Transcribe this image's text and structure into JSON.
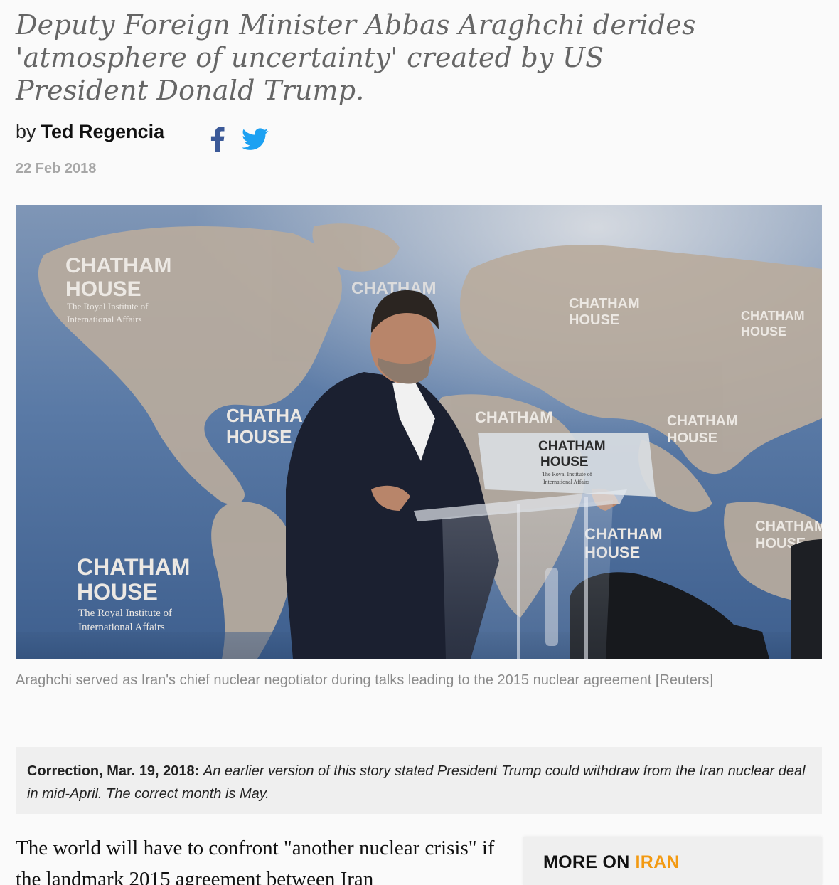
{
  "article": {
    "subhead": "Deputy Foreign Minister Abbas Araghchi derides 'atmosphere of uncertainty' created by US President Donald Trump.",
    "byline_prefix": "by",
    "author": "Ted Regencia",
    "date": "22 Feb 2018",
    "share": {
      "facebook_icon": "facebook-icon",
      "twitter_icon": "twitter-icon",
      "facebook_color": "#3b5998",
      "twitter_color": "#1da1f2"
    },
    "image": {
      "backdrop_logos": [
        {
          "name": "CHATHAM",
          "name2": "HOUSE",
          "sub1": "The Royal Institute of",
          "sub2": "International Affairs"
        }
      ],
      "podium_sign": {
        "line1": "CHATHAM",
        "line2": "HOUSE",
        "sub1": "The Royal Institute of",
        "sub2": "International Affairs"
      }
    },
    "caption": "Araghchi served as Iran's chief nuclear negotiator during talks leading to the 2015 nuclear agreement [Reuters]",
    "correction": {
      "label": "Correction, Mar. 19, 2018:",
      "text": "An earlier version of this story stated President Trump could withdraw from the Iran nuclear deal in mid-April. The correct month is May."
    },
    "body_first_paragraph": "The world will have to confront \"another nuclear crisis\" if the landmark 2015 agreement between Iran"
  },
  "sidebar": {
    "more_on_label": "MORE ON",
    "more_on_topic": "IRAN",
    "topic_color": "#f39a12"
  }
}
